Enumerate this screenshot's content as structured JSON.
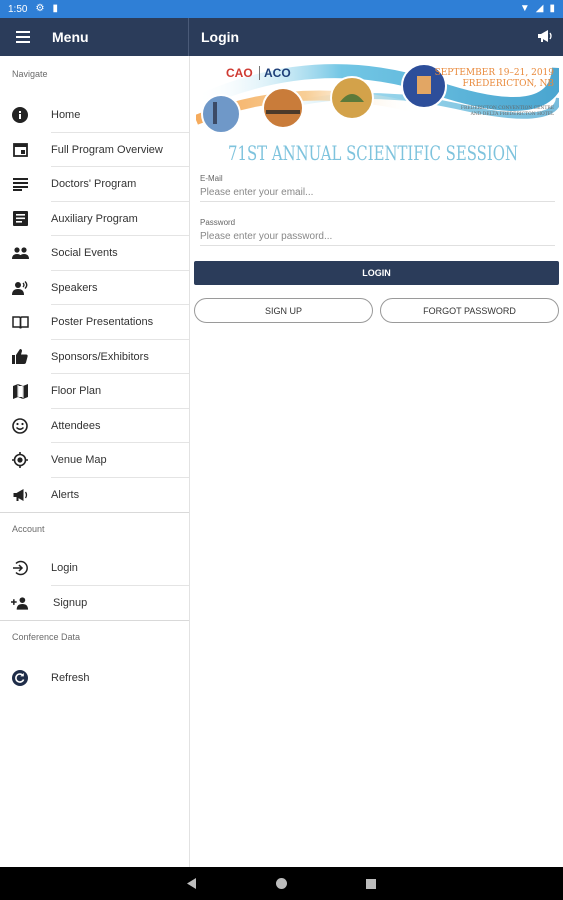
{
  "status_bar": {
    "time": "1:50"
  },
  "app_bar": {
    "menu_title": "Menu",
    "page_title": "Login"
  },
  "sidebar": {
    "navigate_label": "Navigate",
    "navigate_items": [
      {
        "label": "Home",
        "icon": "info-icon"
      },
      {
        "label": "Full Program Overview",
        "icon": "calendar-icon"
      },
      {
        "label": "Doctors' Program",
        "icon": "subject-lines-icon"
      },
      {
        "label": "Auxiliary Program",
        "icon": "article-icon"
      },
      {
        "label": "Social Events",
        "icon": "people-icon"
      },
      {
        "label": "Speakers",
        "icon": "speakers-icon"
      },
      {
        "label": "Poster Presentations",
        "icon": "open-book-icon"
      },
      {
        "label": "Sponsors/Exhibitors",
        "icon": "thumb-up-icon"
      },
      {
        "label": "Floor Plan",
        "icon": "map-icon"
      },
      {
        "label": "Attendees",
        "icon": "smiley-icon"
      },
      {
        "label": "Venue Map",
        "icon": "target-location-icon"
      },
      {
        "label": "Alerts",
        "icon": "megaphone-icon"
      }
    ],
    "account_label": "Account",
    "account_items": [
      {
        "label": "Login",
        "icon": "login-icon"
      },
      {
        "label": "Signup",
        "icon": "person-add-icon"
      }
    ],
    "conference_label": "Conference Data",
    "conference_items": [
      {
        "label": "Refresh",
        "icon": "refresh-icon"
      }
    ]
  },
  "banner": {
    "logo_left": "CAO",
    "logo_right": "ACO",
    "date_line": "SEPTEMBER 19–21, 2019",
    "city_line": "FREDERICTON, NB",
    "venue_line1": "FREDERICTON CONVENTION CENTRE",
    "venue_line2": "AND DELTA FREDERICTON HOTEL",
    "session_title": "71ST ANNUAL SCIENTIFIC SESSION"
  },
  "form": {
    "email_label": "E-Mail",
    "email_placeholder": "Please enter your email...",
    "password_label": "Password",
    "password_placeholder": "Please enter your password...",
    "login_button": "LOGIN",
    "signup_button": "SIGN UP",
    "forgot_button": "FORGOT PASSWORD"
  },
  "colors": {
    "app_bar": "#2b3c5a",
    "status_bar": "#2f7fd6",
    "banner_title": "#7ec3dd",
    "banner_date": "#e98a3c"
  }
}
